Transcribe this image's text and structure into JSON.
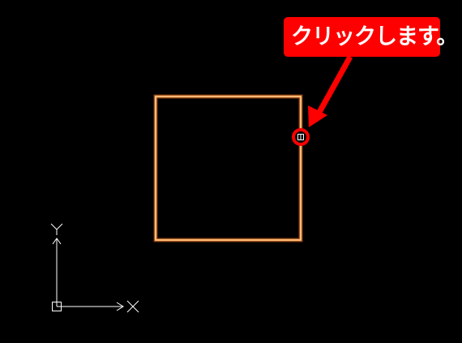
{
  "callout": {
    "text": "クリックします。",
    "color": "#ff0000",
    "text_color": "#ffffff"
  },
  "ucs_icon": {
    "x_label": "X",
    "y_label": "Y",
    "color": "#ffffff"
  },
  "drawing": {
    "rectangle_color": "#ff9a3c",
    "rectangle_glow": "#ffd09a",
    "click_marker_color": "#ff0000",
    "grip_color": "#ffffff"
  },
  "background": "#000000"
}
